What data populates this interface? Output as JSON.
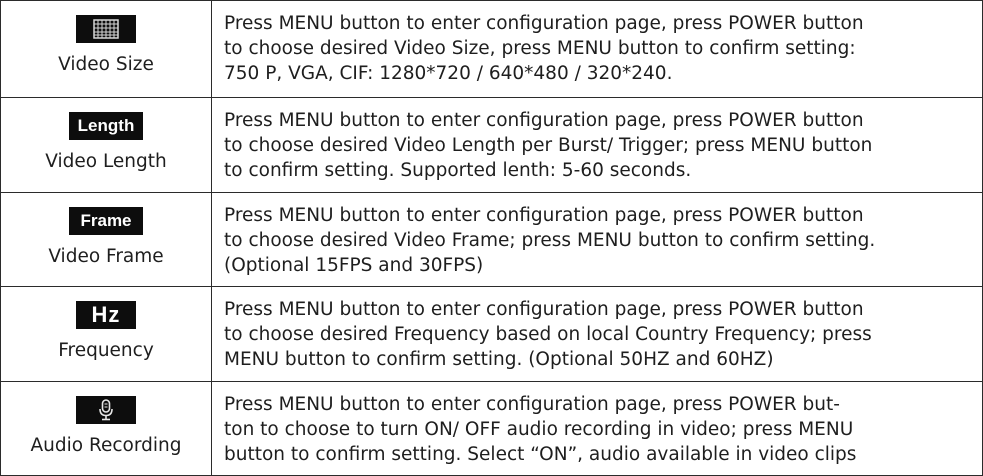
{
  "rows": [
    {
      "icon": "grid-icon",
      "label": "Video Size",
      "lines": [
        "Press MENU button to enter configuration page, press POWER button",
        "to choose desired Video Size, press MENU button   to confirm setting:",
        "750 P, VGA, CIF: 1280*720 / 640*480 / 320*240."
      ]
    },
    {
      "icon": "length-icon",
      "icon_text": "Length",
      "label": "Video Length",
      "lines": [
        "Press MENU button to enter configuration page, press POWER button",
        "to choose desired Video Length per Burst/ Trigger; press MENU button",
        "to confirm setting. Supported lenth: 5-60 seconds."
      ]
    },
    {
      "icon": "frame-icon",
      "icon_text": "Frame",
      "label": "Video Frame",
      "lines": [
        "Press MENU button to enter configuration page, press POWER button",
        "to choose desired Video Frame; press MENU button to confirm setting.",
        "(Optional 15FPS and 30FPS)"
      ]
    },
    {
      "icon": "hz-icon",
      "icon_text": "Hz",
      "label": "Frequency",
      "lines": [
        "Press MENU button to enter configuration page, press POWER button",
        "to choose desired Frequency based on local Country Frequency; press",
        "MENU button to confirm setting. (Optional 50HZ and 60HZ)"
      ]
    },
    {
      "icon": "microphone-icon",
      "label": "Audio Recording",
      "lines": [
        "Press MENU button to enter configuration page, press POWER but-",
        "ton to choose to turn ON/ OFF audio recording in video; press MENU",
        "button to confirm setting. Select “ON”, audio available in video clips"
      ]
    }
  ]
}
